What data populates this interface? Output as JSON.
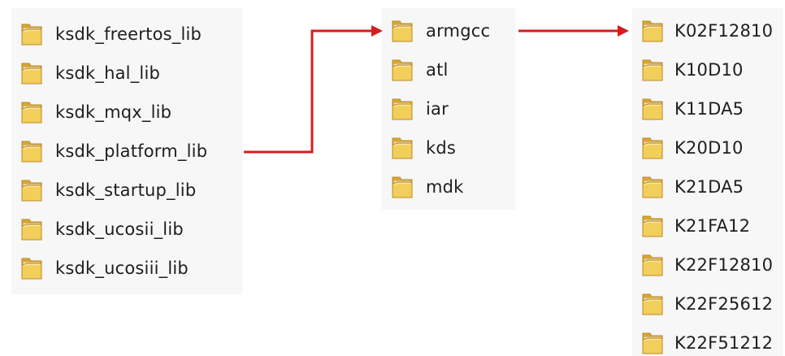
{
  "left_folders": [
    {
      "name": "ksdk_freertos_lib",
      "icon": "folder-icon"
    },
    {
      "name": "ksdk_hal_lib",
      "icon": "folder-icon"
    },
    {
      "name": "ksdk_mqx_lib",
      "icon": "folder-icon"
    },
    {
      "name": "ksdk_platform_lib",
      "icon": "folder-icon"
    },
    {
      "name": "ksdk_startup_lib",
      "icon": "folder-icon"
    },
    {
      "name": "ksdk_ucosii_lib",
      "icon": "folder-icon"
    },
    {
      "name": "ksdk_ucosiii_lib",
      "icon": "folder-icon"
    }
  ],
  "middle_folders": [
    {
      "name": "armgcc",
      "icon": "folder-icon"
    },
    {
      "name": "atl",
      "icon": "folder-icon"
    },
    {
      "name": "iar",
      "icon": "folder-icon"
    },
    {
      "name": "kds",
      "icon": "folder-icon"
    },
    {
      "name": "mdk",
      "icon": "folder-icon"
    }
  ],
  "right_folders": [
    {
      "name": "K02F12810",
      "icon": "folder-icon"
    },
    {
      "name": "K10D10",
      "icon": "folder-icon"
    },
    {
      "name": "K11DA5",
      "icon": "folder-icon"
    },
    {
      "name": "K20D10",
      "icon": "folder-icon"
    },
    {
      "name": "K21DA5",
      "icon": "folder-icon"
    },
    {
      "name": "K21FA12",
      "icon": "folder-icon"
    },
    {
      "name": "K22F12810",
      "icon": "folder-icon"
    },
    {
      "name": "K22F25612",
      "icon": "folder-icon"
    },
    {
      "name": "K22F51212",
      "icon": "folder-icon"
    }
  ],
  "colors": {
    "arrow": "#d81c1c",
    "folder_front": "#f2cf5b",
    "folder_back": "#d9a630",
    "folder_edge": "#b9892a",
    "panel_bg": "#f7f7f7"
  }
}
